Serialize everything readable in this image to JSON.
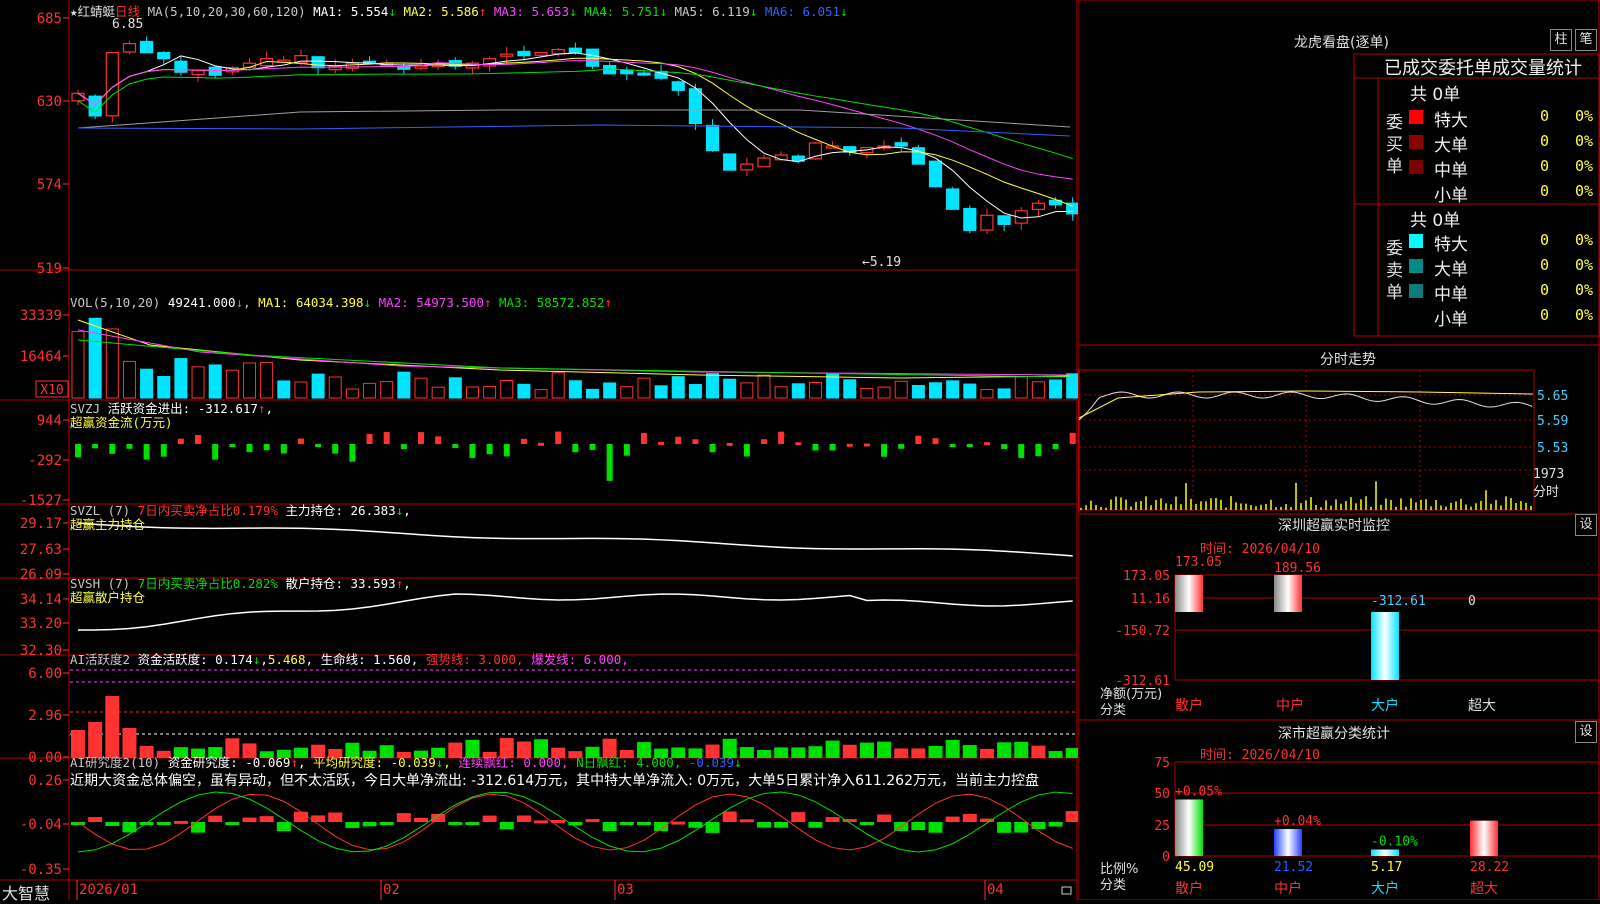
{
  "colors": {
    "up": "#ff3232",
    "down": "#00e4ff",
    "grid": "#b40000",
    "white": "#e6e6e6",
    "yellow": "#ffff40",
    "magenta": "#ff40ff",
    "green": "#00e000",
    "blue": "#3060ff",
    "gray": "#a0a0a0",
    "olive": "#c0c000"
  },
  "main": {
    "star": "★",
    "stock_name": "红蜻蜓",
    "period": "日线",
    "ma_header": "MA(5,10,20,30,60,120)",
    "ma": [
      {
        "label": "MA1: ",
        "value": "5.554",
        "arrow": "↓",
        "color": "#ffffff"
      },
      {
        "label": "MA2: ",
        "value": "5.586",
        "arrow": "↑",
        "color": "#ffff40"
      },
      {
        "label": "MA3: ",
        "value": "5.653",
        "arrow": "↓",
        "color": "#ff40ff"
      },
      {
        "label": "MA4: ",
        "value": "5.751",
        "arrow": "↓",
        "color": "#00e000"
      },
      {
        "label": "MA5: ",
        "value": "6.119",
        "arrow": "↓",
        "color": "#c8c8c8"
      },
      {
        "label": "MA6: ",
        "value": "6.051",
        "arrow": "↓",
        "color": "#3060ff"
      }
    ],
    "y_labels": [
      "685",
      "630",
      "574",
      "519"
    ],
    "max_label": "6.85",
    "min_label": "←5.19"
  },
  "vol": {
    "header": "VOL(5,10,20)",
    "value": "49241.000",
    "arrow": "↓",
    "ma": [
      {
        "label": "MA1: ",
        "value": "64034.398",
        "arrow": "↓",
        "color": "#ffff40"
      },
      {
        "label": "MA2: ",
        "value": "54973.500",
        "arrow": "↑",
        "color": "#ff40ff"
      },
      {
        "label": "MA3: ",
        "value": "58572.852",
        "arrow": "↑",
        "color": "#00e000"
      }
    ],
    "y_labels": [
      "33339",
      "16464"
    ],
    "unit": "X10"
  },
  "svzj": {
    "header": "SVZJ",
    "text": "活跃资金进出: -312.617",
    "arrow": "↑",
    "comma": ",",
    "sub": "超赢资金流(万元)",
    "y_labels": [
      "944",
      "-292",
      "-1527"
    ]
  },
  "svzl": {
    "header": "SVZL (7)",
    "text1": "7日内买卖净占比0.179%",
    "text2": "主力持仓: 26.383",
    "arrow": "↓",
    "comma": ",",
    "sub": "超赢主力持仓",
    "y_labels": [
      "29.17",
      "27.63",
      "26.09"
    ]
  },
  "svsh": {
    "header": "SVSH (7)",
    "text1": "7日内买卖净占比0.282%",
    "text2": "散户持仓: 33.593",
    "arrow": "↑",
    "comma": ",",
    "sub": "超赢散户持仓",
    "y_labels": [
      "34.14",
      "33.20",
      "32.30"
    ]
  },
  "ai1": {
    "header": "AI活跃度2",
    "text1": "资金活跃度: 0.174",
    "arrow1": "↓",
    "comma1": ",",
    "text2": "5.468",
    "comma2": ",",
    "text3": "生命线: 1.560",
    "comma3": ",",
    "text4": "强势线: 3.000",
    "comma4": ",",
    "text5": "爆发线: 6.000",
    "comma5": ",",
    "y_labels": [
      "6.00",
      "2.96",
      "0.00"
    ]
  },
  "ai2": {
    "header": "AI研究度2(10)",
    "text1": "资金研究度: -0.069",
    "arrow1": "↑",
    "comma1": ",",
    "text2": "平均研究度: -0.039",
    "arrow2": "↓",
    "comma2": ",",
    "text3": "连续飘红: 0.000",
    "comma3": ",",
    "text4": "N日飘红: 4.000",
    "comma4": ",",
    "text5": "-0.039",
    "arrow5": "↓",
    "comment": "近期大资金总体偏空，虽有异动，但不太活跃，今日大单净流出: -312.614万元，其中特大单净流入: 0万元，大单5日累计净入611.262万元，当前主力控盘",
    "y_labels": [
      "0.26",
      "-0.04",
      "-0.35"
    ]
  },
  "xaxis": {
    "labels": [
      "2026/01",
      "02",
      "03",
      "04"
    ]
  },
  "bottom_logo": "大智慧",
  "right": {
    "lhb": {
      "title": "龙虎看盘(逐单)",
      "btn1": "柱",
      "btn2": "笔",
      "subtitle": "已成交委托单成交量统计",
      "buy": {
        "side": "委买单",
        "total": "共 0单",
        "rows": [
          {
            "label": "特大",
            "v": "0",
            "p": "0%",
            "color": "#ff0000"
          },
          {
            "label": "大单",
            "v": "0",
            "p": "0%",
            "color": "#8b0000"
          },
          {
            "label": "中单",
            "v": "0",
            "p": "0%",
            "color": "#7a0000"
          },
          {
            "label": "小单",
            "v": "0",
            "p": "0%",
            "color": "#000000"
          }
        ]
      },
      "sell": {
        "side": "委卖单",
        "total": "共 0单",
        "rows": [
          {
            "label": "特大",
            "v": "0",
            "p": "0%",
            "color": "#00ffff"
          },
          {
            "label": "大单",
            "v": "0",
            "p": "0%",
            "color": "#008b8b"
          },
          {
            "label": "中单",
            "v": "0",
            "p": "0%",
            "color": "#0a7a7a"
          },
          {
            "label": "小单",
            "v": "0",
            "p": "0%",
            "color": "#000000"
          }
        ]
      }
    },
    "fs": {
      "title": "分时走势",
      "y_labels": [
        "5.65",
        "5.59",
        "5.53"
      ],
      "vol_label": "1973",
      "unit": "分时"
    },
    "sz_monitor": {
      "title": "深圳超赢实时监控",
      "btn": "设",
      "time": "时间: 2026/04/10",
      "y_labels": [
        "173.05",
        "11.16",
        "-150.72",
        "-312.61"
      ],
      "y_title": "净额(万元)",
      "x_title": "分类",
      "categories": [
        "散户",
        "中户",
        "大户",
        "超大"
      ],
      "bar_labels": [
        "173.05",
        "189.56",
        "-312.61",
        "0"
      ]
    },
    "sz_stats": {
      "title": "深市超赢分类统计",
      "btn": "设",
      "time": "时间: 2026/04/10",
      "y_labels": [
        "75",
        "50",
        "25",
        "0"
      ],
      "y_title": "比例%",
      "x_title": "分类",
      "categories": [
        "散户",
        "中户",
        "大户",
        "超大"
      ],
      "top_labels": [
        "+0.05%",
        "+0.04%",
        "-0.10%",
        ""
      ],
      "bottom_labels": [
        "45.09",
        "21.52",
        "5.17",
        "28.22"
      ]
    }
  },
  "chart_data": [
    {
      "type": "candlestick",
      "title": "红蜻蜓 日线",
      "ylim": [
        5.19,
        6.85
      ],
      "y_ticks": [
        "685",
        "630",
        "574",
        "519"
      ],
      "x_ticks": [
        "2026/01",
        "02",
        "03",
        "04"
      ],
      "max": "6.85",
      "min": "5.19",
      "series": [
        {
          "name": "MA1",
          "value": 5.554
        },
        {
          "name": "MA2",
          "value": 5.586
        },
        {
          "name": "MA3",
          "value": 5.653
        },
        {
          "name": "MA4",
          "value": 5.751
        },
        {
          "name": "MA5",
          "value": 6.119
        },
        {
          "name": "MA6",
          "value": 6.051
        }
      ]
    },
    {
      "type": "bar",
      "title": "VOL(5,10,20)",
      "last": 49241.0,
      "y_ticks": [
        "33339",
        "16464"
      ],
      "series": [
        {
          "name": "MA1",
          "value": 64034.398
        },
        {
          "name": "MA2",
          "value": 54973.5
        },
        {
          "name": "MA3",
          "value": 58572.852
        }
      ]
    },
    {
      "type": "bar",
      "title": "SVZJ",
      "last": -312.617,
      "ylim": [
        -1527,
        944
      ]
    },
    {
      "type": "line",
      "title": "SVZL (7)",
      "last": 26.383,
      "ylim": [
        26.09,
        29.17
      ]
    },
    {
      "type": "line",
      "title": "SVSH (7)",
      "last": 33.593,
      "ylim": [
        32.3,
        34.14
      ]
    },
    {
      "type": "bar",
      "title": "AI活跃度2",
      "last": 0.174,
      "ylim": [
        0,
        6
      ]
    },
    {
      "type": "bar",
      "title": "AI研究度2(10)",
      "last": -0.069,
      "ylim": [
        -0.35,
        0.26
      ]
    },
    {
      "type": "bar",
      "title": "深圳超赢实时监控",
      "categories": [
        "散户",
        "中户",
        "大户",
        "超大"
      ],
      "values": [
        173.05,
        189.56,
        -312.61,
        0
      ],
      "ylim": [
        -312.61,
        173.05
      ]
    },
    {
      "type": "bar",
      "title": "深市超赢分类统计",
      "categories": [
        "散户",
        "中户",
        "大户",
        "超大"
      ],
      "values": [
        45.09,
        21.52,
        5.17,
        28.22
      ],
      "changes": [
        "+0.05%",
        "+0.04%",
        "-0.10%",
        ""
      ],
      "ylim": [
        0,
        75
      ]
    }
  ]
}
